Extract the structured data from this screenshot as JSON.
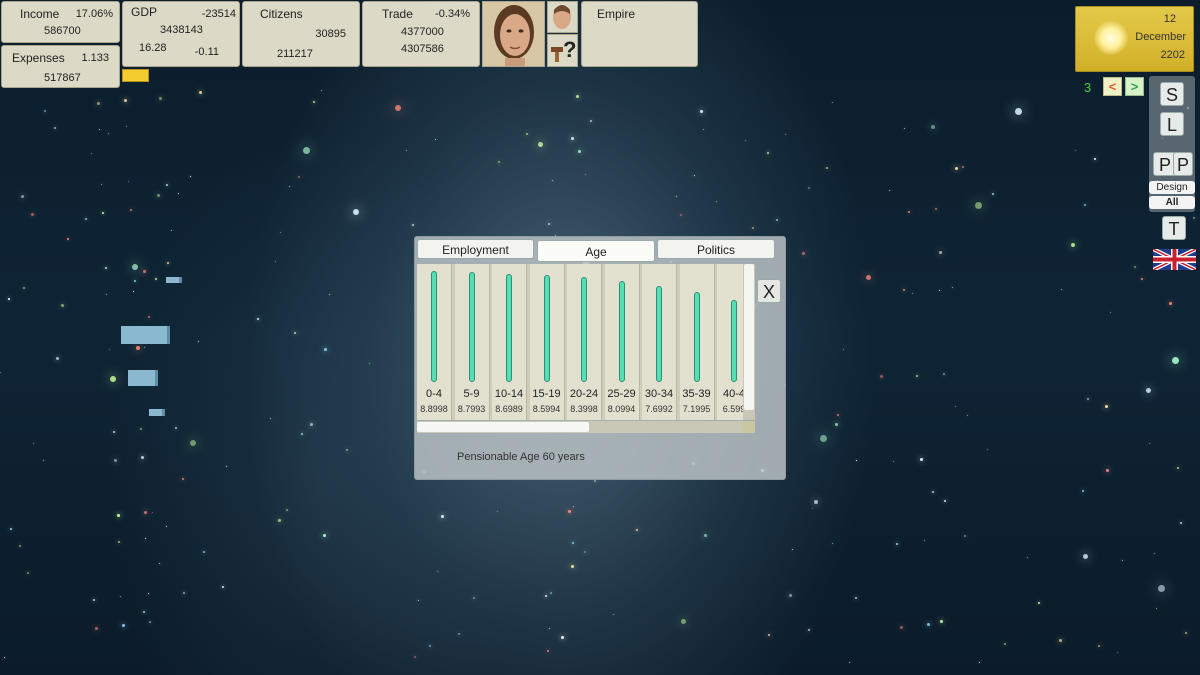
{
  "income": {
    "label": "Income",
    "percent": "17.06%",
    "value": "586700"
  },
  "expenses": {
    "label": "Expenses",
    "ratio": "1.133",
    "value": "517867"
  },
  "gdp": {
    "label": "GDP",
    "change": "-23514",
    "value": "3438143",
    "rate": "16.28",
    "delta": "-0.11"
  },
  "citizens": {
    "label": "Citizens",
    "value1": "30895",
    "value2": "211217"
  },
  "trade": {
    "label": "Trade",
    "percent": "-0.34%",
    "value1": "4377000",
    "value2": "4307586"
  },
  "empire": {
    "label": "Empire"
  },
  "help_glyph": "?",
  "date": {
    "day": "12",
    "month": "December",
    "year": "2202"
  },
  "speed": {
    "value": "3",
    "prev": "<",
    "next": ">"
  },
  "side": {
    "s": "S",
    "l": "L",
    "p1": "P",
    "p2": "P",
    "design": "Design",
    "all": "All",
    "t": "T"
  },
  "dialog": {
    "tabs": [
      {
        "label": "Employment"
      },
      {
        "label": "Age"
      },
      {
        "label": "Politics"
      }
    ],
    "active_tab": "Age",
    "close": "X",
    "pension": "Pensionable Age 60 years",
    "bar_max": 9.0,
    "age_groups": [
      {
        "label": "0-4",
        "value": "8.8998",
        "v": 8.8998
      },
      {
        "label": "5-9",
        "value": "8.7993",
        "v": 8.7993
      },
      {
        "label": "10-14",
        "value": "8.6989",
        "v": 8.6989
      },
      {
        "label": "15-19",
        "value": "8.5994",
        "v": 8.5994
      },
      {
        "label": "20-24",
        "value": "8.3998",
        "v": 8.3998
      },
      {
        "label": "25-29",
        "value": "8.0994",
        "v": 8.0994
      },
      {
        "label": "30-34",
        "value": "7.6992",
        "v": 7.6992
      },
      {
        "label": "35-39",
        "value": "7.1995",
        "v": 7.1995
      },
      {
        "label": "40-4",
        "value": "6.599",
        "v": 6.599
      }
    ]
  },
  "colors": {
    "bar": "#54e0b4",
    "panel": "#dcd9c6",
    "sun": "#fff2a0"
  },
  "icons": {
    "portrait": "advisor-portrait-icon",
    "small_portrait": "small-face-icon",
    "help": "hammer-question-icon",
    "sun": "sun-icon",
    "flag": "uk-flag-icon"
  }
}
